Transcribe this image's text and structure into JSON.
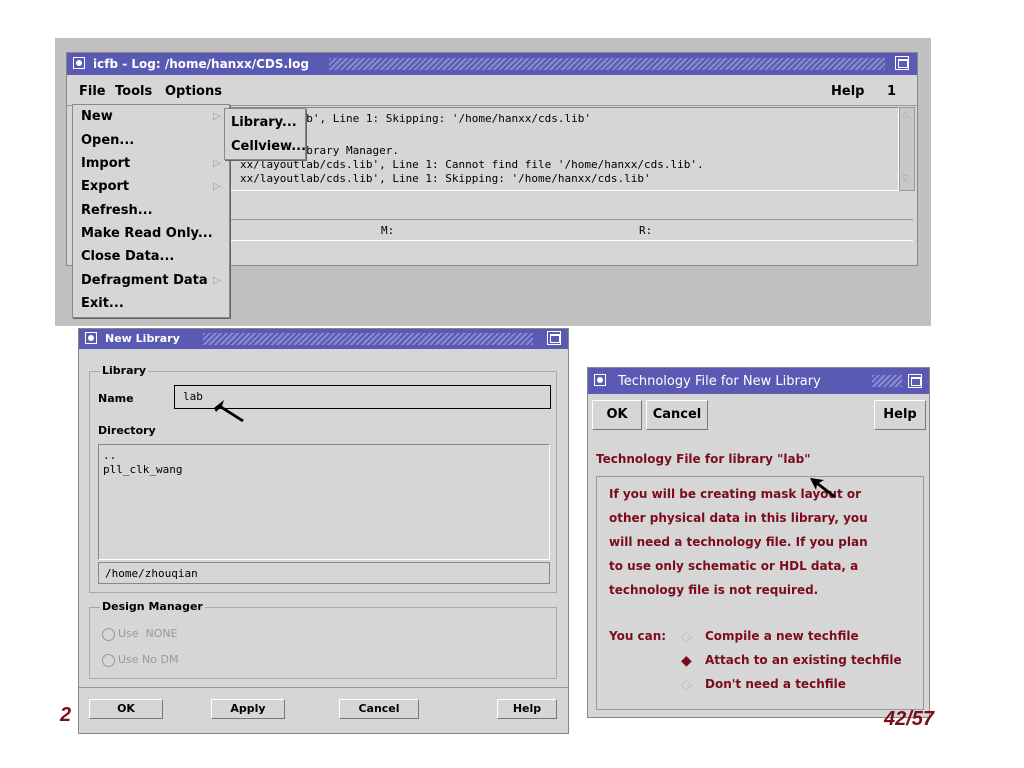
{
  "log_window": {
    "title": "icfb - Log: /home/hanxx/CDS.log",
    "menu": {
      "file": "File",
      "tools": "Tools",
      "options": "Options",
      "help": "Help",
      "number": "1"
    },
    "log_lines": [
      "lab/cds.lib', Line 1: Skipping: '/home/hanxx/cds.lib'",
      "ith the Library Manager.",
      "xx/layoutlab/cds.lib', Line 1: Cannot find file '/home/hanxx/cds.lib'.",
      "xx/layoutlab/cds.lib', Line 1: Skipping: '/home/hanxx/cds.lib'"
    ],
    "status": {
      "m": "M:",
      "r": "R:"
    }
  },
  "file_menu": {
    "items": [
      "New",
      "Open...",
      "Import",
      "Export",
      "Refresh...",
      "Make Read Only...",
      "Close Data...",
      "Defragment Data",
      "Exit..."
    ]
  },
  "new_submenu": {
    "items": [
      "Library...",
      "Cellview..."
    ]
  },
  "new_library": {
    "title": "New Library",
    "library_group": "Library",
    "name_label": "Name",
    "name_value": "lab",
    "directory_label": "Directory",
    "dir_entries": [
      "..",
      "pll_clk_wang"
    ],
    "path_value": "/home/zhouqian",
    "design_manager_group": "Design Manager",
    "dm_options": [
      "Use  NONE",
      "Use No DM"
    ],
    "buttons": {
      "ok": "OK",
      "apply": "Apply",
      "cancel": "Cancel",
      "help": "Help"
    }
  },
  "tech_dialog": {
    "title": "Technology File for New Library",
    "buttons": {
      "ok": "OK",
      "cancel": "Cancel",
      "help": "Help"
    },
    "heading": "Technology File for library \"lab\"",
    "body_lines": [
      "If you will be creating mask layout or",
      "other physical data in this library, you",
      "will need a technology file. If you plan",
      "to use only schematic or HDL data, a",
      "technology file is not required."
    ],
    "you_can": "You can:",
    "options": [
      "Compile a new techfile",
      "Attach to an existing techfile",
      "Don't need a techfile"
    ],
    "selected_option": 1
  },
  "slide": {
    "left_fragment": "2",
    "page": "42/57"
  },
  "colors": {
    "title_bar": "#5a5ab4",
    "panel": "#d6d6d6",
    "accent_red": "#7b0c1c"
  }
}
